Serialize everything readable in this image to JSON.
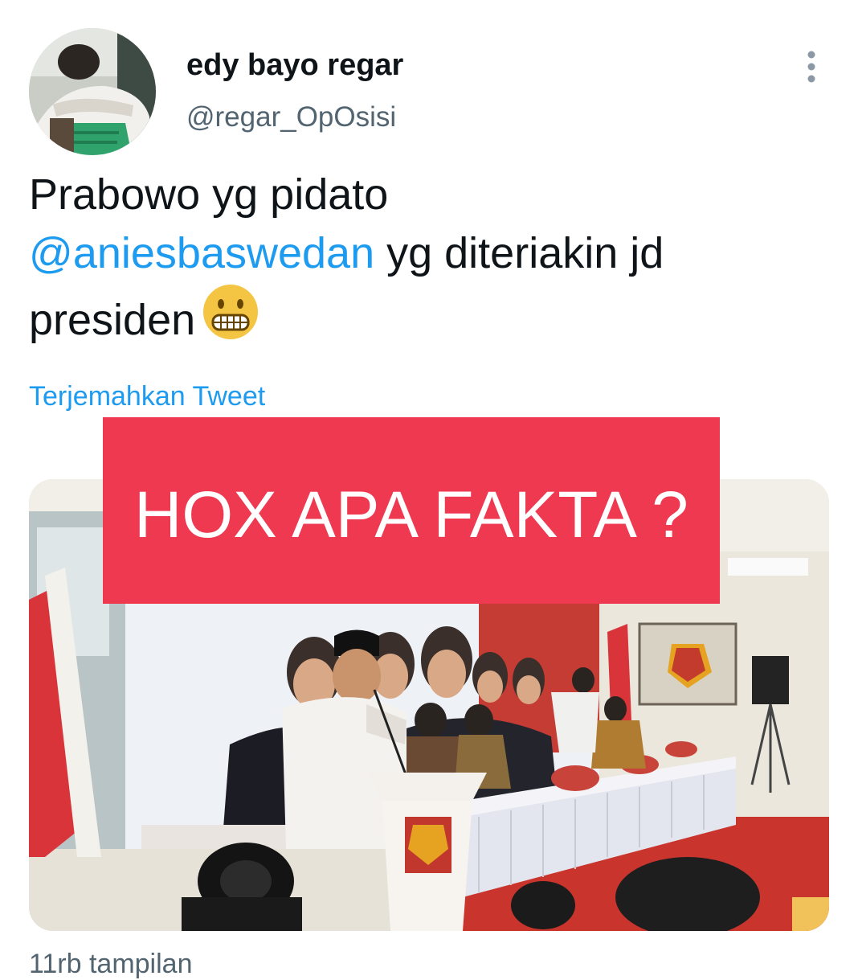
{
  "author": {
    "display_name": "edy bayo regar",
    "handle": "@regar_OpOsisi",
    "avatar_icon": "user-avatar-photo"
  },
  "tweet": {
    "text_line1": "Prabowo yg pidato",
    "mention": "@aniesbaswedan",
    "text_after_mention": " yg diteriakin jd",
    "text_line3": "presiden",
    "emoji_icon": "grimacing-face-emoji",
    "translate_label": "Terjemahkan Tweet"
  },
  "media": {
    "overlay_text": "HOX APA FAKTA ?",
    "overlay_color": "#ef3951"
  },
  "footer": {
    "views": "11rb tampilan"
  },
  "colors": {
    "link": "#1d9bf0",
    "secondary_text": "#536471",
    "primary_text": "#0f1419"
  }
}
